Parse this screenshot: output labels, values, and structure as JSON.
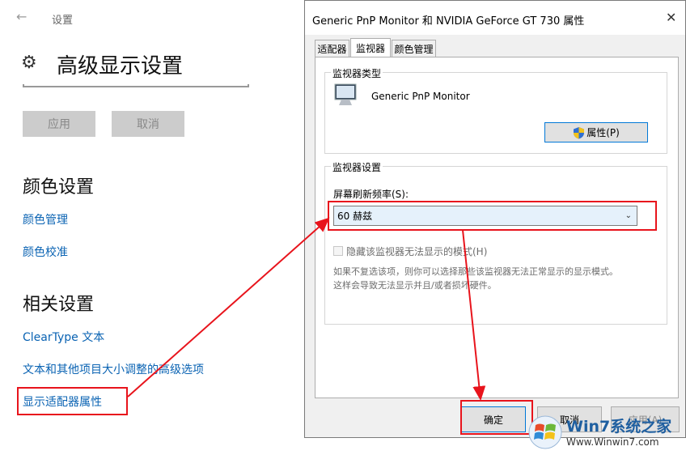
{
  "settings": {
    "breadcrumb": "设置",
    "page_title": "高级显示设置",
    "apply_button": "应用",
    "cancel_button": "取消",
    "color_section_title": "颜色设置",
    "color_links": [
      "颜色管理",
      "颜色校准"
    ],
    "related_section_title": "相关设置",
    "related_links": [
      "ClearType 文本",
      "文本和其他项目大小调整的高级选项",
      "显示适配器属性"
    ]
  },
  "dialog": {
    "title": "Generic PnP Monitor 和 NVIDIA GeForce GT 730 属性",
    "close_glyph": "✕",
    "tabs": [
      "适配器",
      "监视器",
      "颜色管理"
    ],
    "active_tab": "监视器",
    "monitor_type_group": "监视器类型",
    "monitor_name": "Generic PnP Monitor",
    "properties_button": "属性(P)",
    "monitor_settings_group": "监视器设置",
    "refresh_rate_label": "屏幕刷新频率(S):",
    "refresh_rate_value": "60 赫兹",
    "hide_modes_checkbox": "隐藏该监视器无法显示的模式(H)",
    "hide_modes_checked": false,
    "hint_line1": "如果不复选该项，则你可以选择那些该监视器无法正常显示的显示模式。",
    "hint_line2": "这样会导致无法显示并且/或者损坏硬件。",
    "ok_button": "确定",
    "cancel_button": "取消",
    "apply_button": "应用(A)"
  },
  "watermark": {
    "brand": "Win7系统之家",
    "url": "Www.Winwin7.com"
  },
  "colors": {
    "link": "#0a63b3",
    "annotation_red": "#e8141c"
  }
}
